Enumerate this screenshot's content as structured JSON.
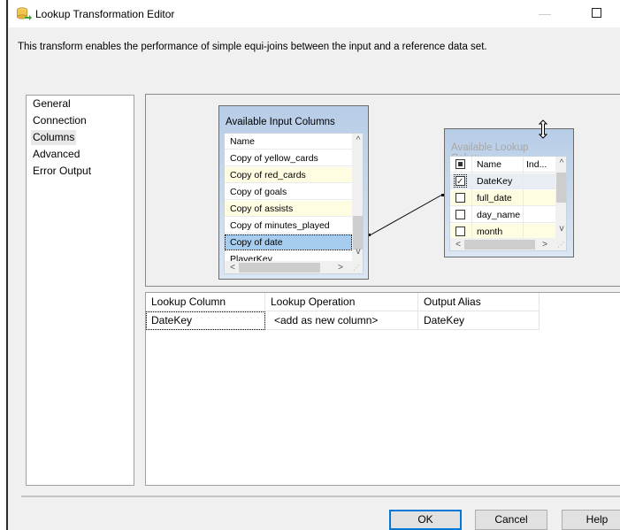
{
  "window": {
    "title": "Lookup Transformation Editor",
    "description": "This transform enables the performance of simple equi-joins between the input and a reference data set."
  },
  "nav": {
    "items": [
      {
        "label": "General",
        "selected": false
      },
      {
        "label": "Connection",
        "selected": false
      },
      {
        "label": "Columns",
        "selected": true
      },
      {
        "label": "Advanced",
        "selected": false
      },
      {
        "label": "Error Output",
        "selected": false
      }
    ]
  },
  "input_columns": {
    "title": "Available Input Columns",
    "header": "Name",
    "rows": [
      {
        "label": "Copy of yellow_cards",
        "state": "normal"
      },
      {
        "label": "Copy of red_cards",
        "state": "yellow"
      },
      {
        "label": "Copy of goals",
        "state": "normal"
      },
      {
        "label": "Copy of assists",
        "state": "yellow"
      },
      {
        "label": "Copy of minutes_played",
        "state": "normal"
      },
      {
        "label": "Copy of date",
        "state": "selected"
      },
      {
        "label": "PlayerKey",
        "state": "normal"
      }
    ]
  },
  "lookup_columns": {
    "title": "Available Lookup Colum...",
    "headers": {
      "name": "Name",
      "index": "Ind..."
    },
    "rows": [
      {
        "label": "DateKey",
        "checked": true
      },
      {
        "label": "full_date",
        "checked": false
      },
      {
        "label": "day_name",
        "checked": false
      },
      {
        "label": "month",
        "checked": false
      }
    ]
  },
  "mapping": {
    "from": "Copy of date",
    "to": "DateKey"
  },
  "grid": {
    "headers": [
      "Lookup Column",
      "Lookup Operation",
      "Output Alias"
    ],
    "rows": [
      [
        "DateKey",
        "<add as new column>",
        "DateKey"
      ]
    ]
  },
  "buttons": {
    "ok": "OK",
    "cancel": "Cancel",
    "help": "Help"
  },
  "colors": {
    "selection": "#a6cdf0",
    "alt_row": "#fffde1",
    "default_button_border": "#0078d7"
  }
}
